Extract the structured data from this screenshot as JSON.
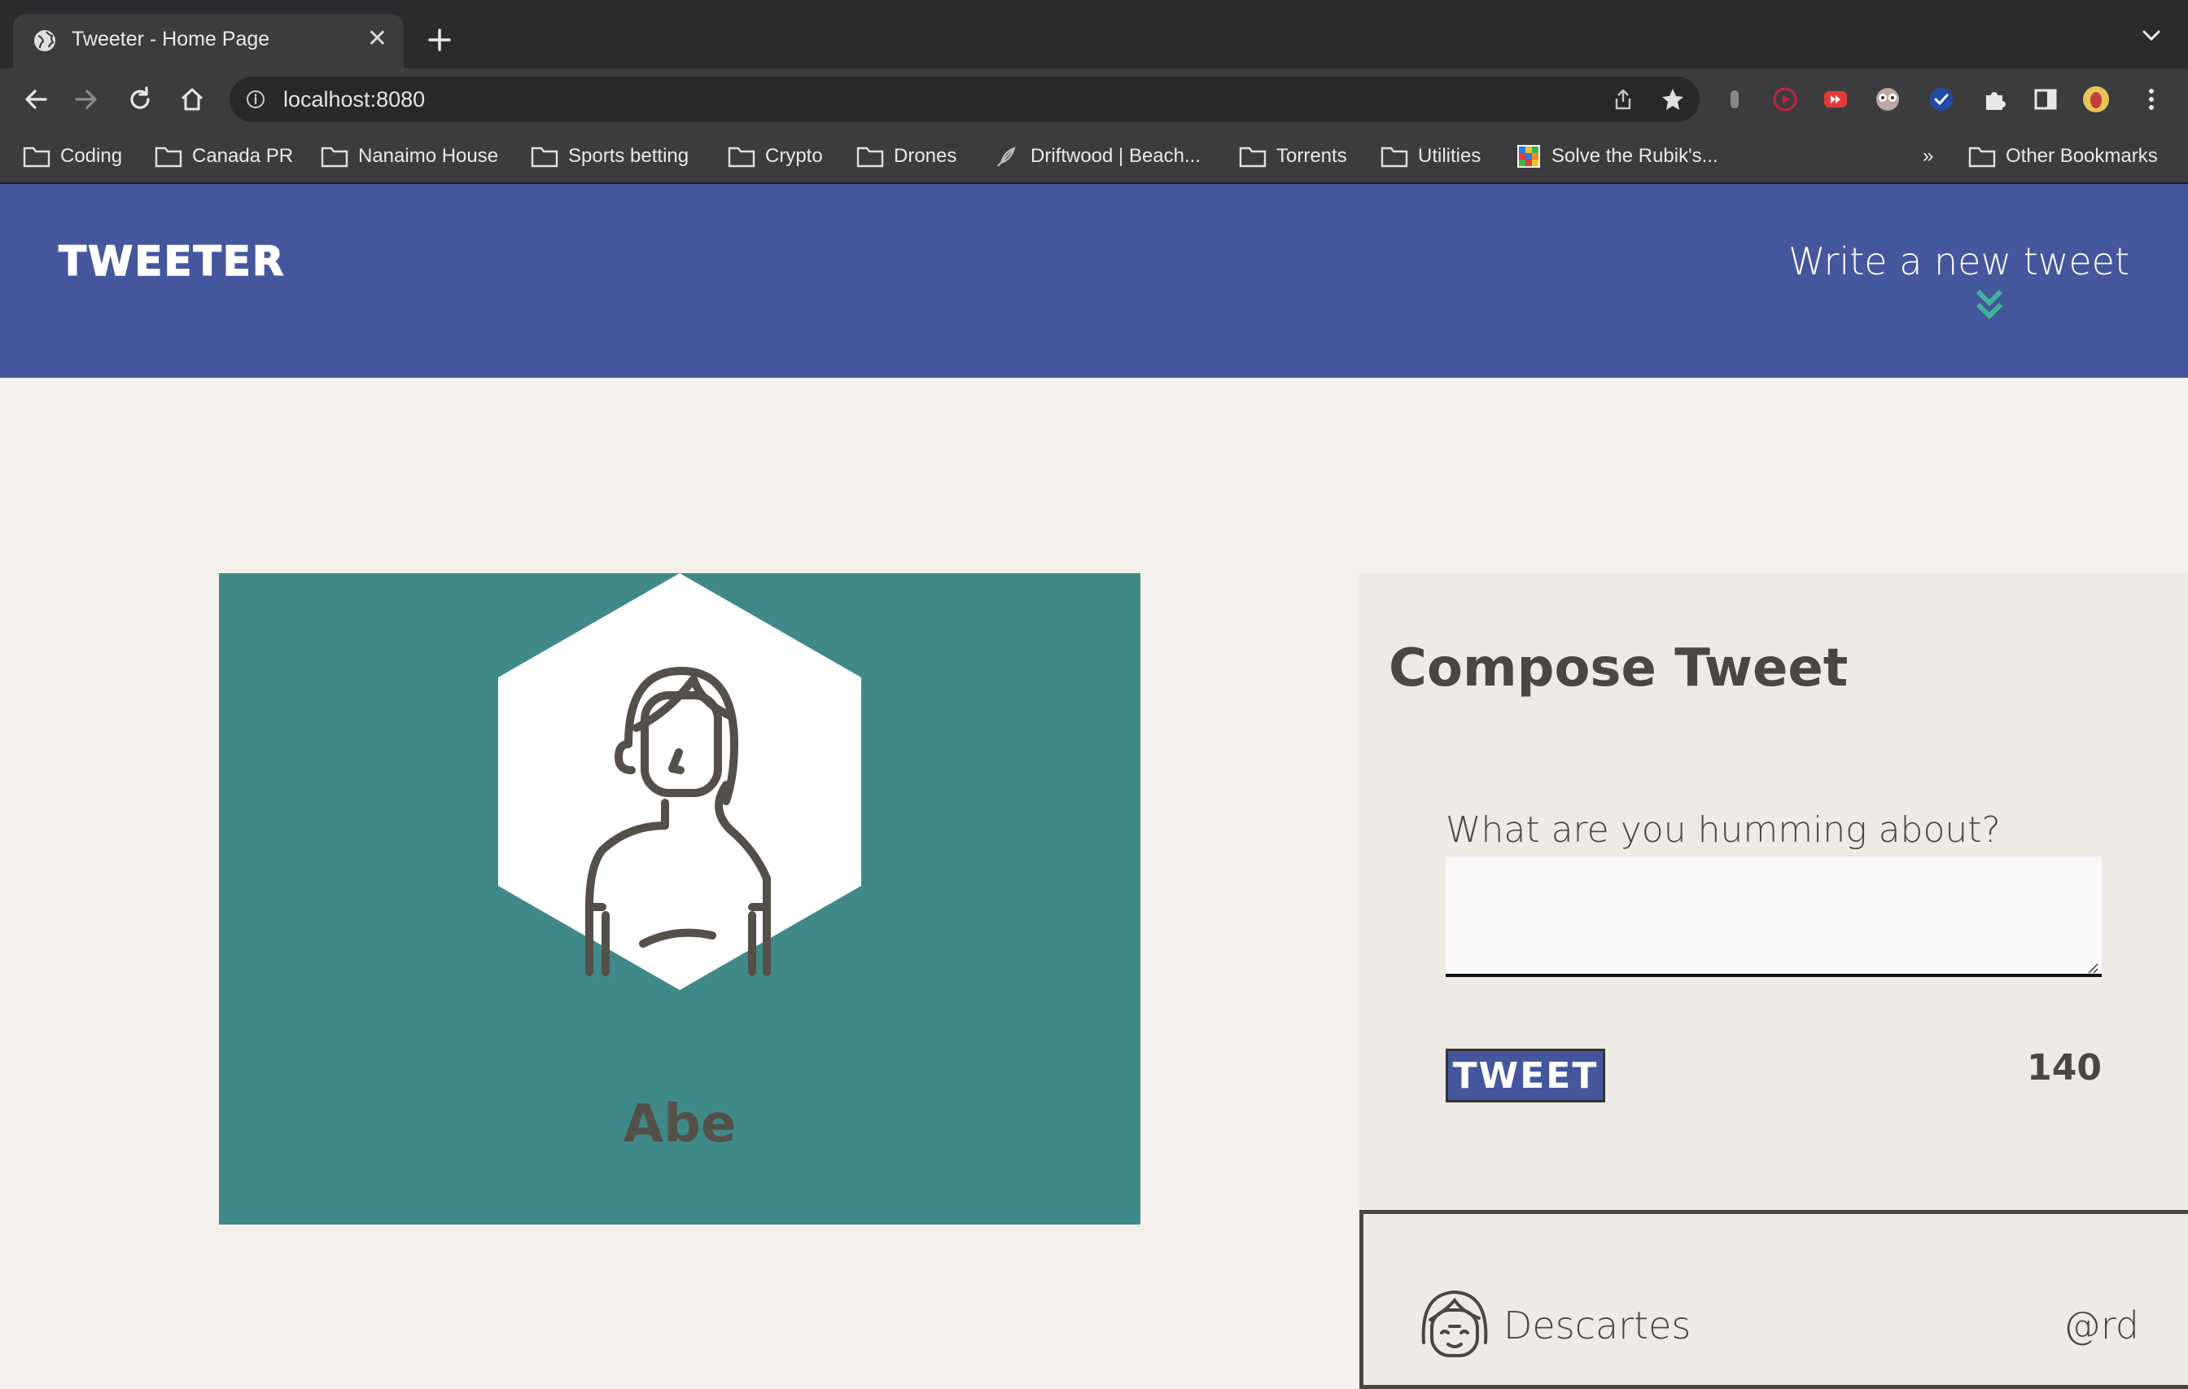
{
  "browser": {
    "tab_title": "Tweeter - Home Page",
    "tab_close": "✕",
    "url": "localhost:8080",
    "bookmarks": [
      {
        "label": "Coding",
        "icon": "folder-icon"
      },
      {
        "label": "Canada PR",
        "icon": "folder-icon"
      },
      {
        "label": "Nanaimo House",
        "icon": "folder-icon"
      },
      {
        "label": "Sports betting",
        "icon": "folder-icon"
      },
      {
        "label": "Crypto",
        "icon": "folder-icon"
      },
      {
        "label": "Drones",
        "icon": "folder-icon"
      },
      {
        "label": "Driftwood | Beach...",
        "icon": "feather-icon"
      },
      {
        "label": "Torrents",
        "icon": "folder-icon"
      },
      {
        "label": "Utilities",
        "icon": "folder-icon"
      },
      {
        "label": "Solve the Rubik's...",
        "icon": "rubiks-icon"
      }
    ],
    "more_bookmarks": "»",
    "other_bookmarks": "Other Bookmarks"
  },
  "header": {
    "logo": "TWEETER",
    "write_new": "Write a new tweet"
  },
  "profile": {
    "name": "Abe"
  },
  "compose": {
    "title": "Compose Tweet",
    "label": "What are you humming about?",
    "text_value": "",
    "button_label": "TWEET",
    "counter": "140"
  },
  "tweet": {
    "user": "Descartes",
    "handle": "@rd"
  },
  "colors": {
    "header_bg": "#44569c",
    "accent_teal": "#3f8a88",
    "page_bg": "#f4f1ec",
    "text_dark": "#4a4741"
  }
}
